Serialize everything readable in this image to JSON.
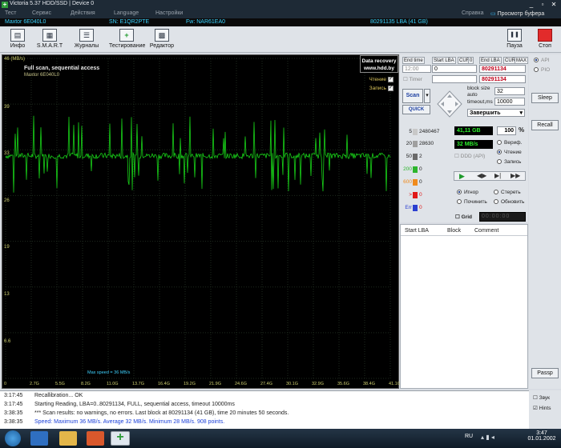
{
  "window": {
    "title": "Victoria 5.37 HDD/SSD | Device 0",
    "buttons": {
      "minimize": "_",
      "maximize": "▫",
      "close": "✕"
    }
  },
  "menu": {
    "items": [
      "Тест",
      "Сервис",
      "Действия",
      "Language",
      "Настройки",
      "Справка"
    ],
    "viewer": "Просмотр буфера"
  },
  "drive": {
    "model": "Maxtor 6E040L0",
    "serial": "SN: E1QR2PTE",
    "firmware": "Fw: NAR61EA0",
    "capacity": "80291135 LBA (41 GB)"
  },
  "toolbar": {
    "buttons": [
      "Инфо",
      "S.M.A.R.T",
      "Журналы",
      "Тестирование",
      "Редактор"
    ],
    "pause": "Пауза",
    "stop": "Стоп"
  },
  "chart": {
    "title": "Full scan, sequential access",
    "subtitle": "Maxtor 6E040L0",
    "unit_label": "46 (MB/s)",
    "y_labels": [
      "39",
      "33",
      "26",
      "19",
      "13",
      "6.6"
    ],
    "x_labels": [
      "0",
      "2.7G",
      "5.5G",
      "8.2G",
      "11.0G",
      "13.7G",
      "16.4G",
      "19.2G",
      "21.9G",
      "24.6G",
      "27.4G",
      "30.1G",
      "32.9G",
      "35.6G",
      "38.4G",
      "41.1G"
    ],
    "data_recovery": [
      "Data recovery",
      "www.hdd.by"
    ],
    "legend": [
      {
        "label": "Чтение",
        "color": "#e0c020"
      },
      {
        "label": "Запись",
        "color": "#e0c020"
      }
    ],
    "max_speed": "Max speed = 36 MB/s",
    "line_color": "#18d018"
  },
  "chart_data": {
    "type": "line",
    "ylim": [
      0,
      46
    ],
    "xlim": [
      0,
      41.1
    ],
    "series": [
      {
        "x": [
          0,
          2.7,
          5.5,
          8.2,
          11.0,
          13.7,
          16.4,
          19.2,
          21.9,
          24.6,
          27.4,
          30.1,
          32.9,
          35.6,
          38.4,
          41.1
        ],
        "y": [
          32,
          32,
          32,
          32,
          32,
          32,
          32,
          32,
          32,
          32,
          32,
          32,
          32,
          32,
          32,
          32
        ]
      }
    ]
  },
  "panel": {
    "headers": [
      "End time",
      "Start LBA",
      "CUR",
      "0",
      "End LBA",
      "CUR",
      "MAX"
    ],
    "time": "12:00",
    "start_lba": "0",
    "end_lba": "80291134",
    "end_lba_cur": "80291134",
    "timer_label": "Timer",
    "block_size_label": "block size",
    "auto_label": "auto",
    "block_size": "32",
    "timeout_label": "timeout,ms",
    "timeout": "10000",
    "scan": "Scan",
    "quick": "QUICK",
    "finish": "Завершить",
    "counts": [
      {
        "label": "5",
        "value": "2480467",
        "color": "#c8c8c8"
      },
      {
        "label": "20",
        "value": "28630",
        "color": "#a0a0a0"
      },
      {
        "label": "50",
        "value": "2",
        "color": "#6a6a6a"
      },
      {
        "label": "200",
        "value": "0",
        "color": "#2cb52c"
      },
      {
        "label": "600",
        "value": "0",
        "color": "#f08a1c"
      },
      {
        "label": ">",
        "value": "0",
        "color": "#e01818"
      },
      {
        "label": "Err",
        "value": "0",
        "color": "#2a3fd0"
      }
    ],
    "size_gb": "41,11 GB",
    "percent": "100",
    "percent_sign": "%",
    "speed": "32 MB/s",
    "ddd": "DDD (API)",
    "verify": "Вериф.",
    "read": "Чтение",
    "write": "Запись",
    "ignore": "Игнор",
    "erase": "Стереть",
    "repair": "Починить",
    "update": "Обновить",
    "grid": "Grid",
    "grid_time": "00:00:00"
  },
  "table": {
    "columns": [
      "Start LBA",
      "Block",
      "Comment"
    ]
  },
  "side": {
    "api": "API",
    "pio": "PIO",
    "sleep": "Sleep",
    "recall": "Recall",
    "passp": "Passp"
  },
  "log": [
    {
      "time": "3:17:45",
      "text": "Recallibration... OK",
      "color": "#222222"
    },
    {
      "time": "3:17:45",
      "text": "Starting Reading, LBA=0..80291134, FULL, sequential access, timeout 10000ms",
      "color": "#222222"
    },
    {
      "time": "3:38:35",
      "text": "*** Scan results: no warnings, no errors. Last block at 80291134 (41 GB), time 20 minutes 50 seconds.",
      "color": "#222222"
    },
    {
      "time": "3:38:35",
      "text": "Speed: Maximum 36 MB/s. Average 32 MB/s. Minimum 28 MB/s. 908 points.",
      "color": "#1a3fd8"
    }
  ],
  "log_side": {
    "sound": "Звук",
    "hints": "Hints"
  },
  "taskbar": {
    "lang": "RU",
    "time": "3:47",
    "date": "01.01.2002"
  }
}
